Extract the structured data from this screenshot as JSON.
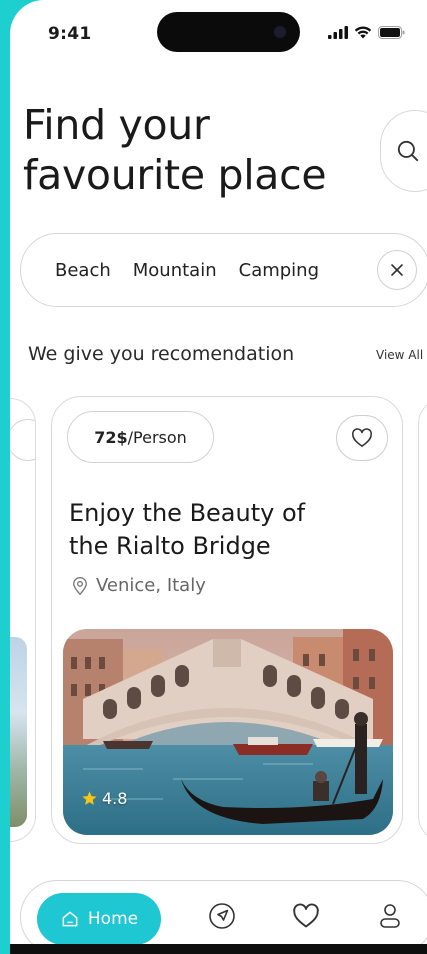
{
  "status_bar": {
    "time": "9:41"
  },
  "header": {
    "title_line1": "Find your",
    "title_line2": "favourite place"
  },
  "categories": [
    {
      "label": "Beach"
    },
    {
      "label": "Mountain"
    },
    {
      "label": "Camping"
    }
  ],
  "recommendation": {
    "heading": "We give you recomendation",
    "view_all": "View All"
  },
  "card": {
    "price": "72$",
    "price_unit": "/Person",
    "title_line1": "Enjoy the Beauty of",
    "title_line2": "the Rialto Bridge",
    "location": "Venice, Italy",
    "rating": "4.8"
  },
  "nav": {
    "home_label": "Home"
  },
  "colors": {
    "accent": "#1ec7d2",
    "frame": "#1ecfd0",
    "star": "#f5c518"
  },
  "icons": {
    "search": "search-icon",
    "clear": "close-icon",
    "favorite": "heart-icon",
    "location": "location-pin-icon",
    "star": "star-icon",
    "home": "home-icon",
    "explore": "navigation-icon",
    "saved": "heart-icon",
    "profile": "user-icon"
  }
}
